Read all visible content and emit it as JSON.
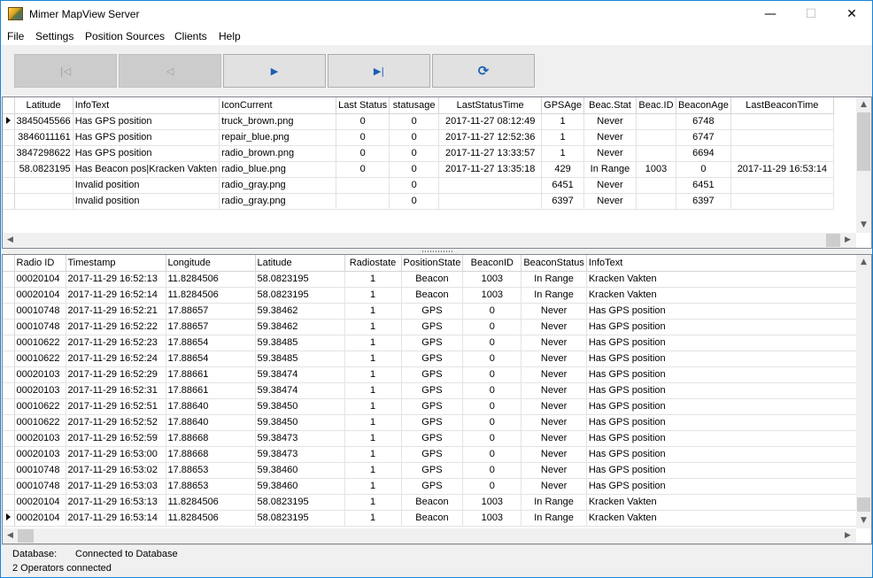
{
  "window": {
    "title": "Mimer MapView Server",
    "minimize_glyph": "—",
    "maximize_glyph": "☐",
    "close_glyph": "✕"
  },
  "menu": [
    "File",
    "Settings",
    "Position Sources",
    "Clients",
    "Help"
  ],
  "toolbar": {
    "first_glyph": "|◁",
    "prev_glyph": "◁",
    "play_glyph": "▶",
    "last_glyph": "▶|",
    "refresh_glyph": "⟳"
  },
  "top_grid": {
    "columns": [
      "Latitude",
      "InfoText",
      "IconCurrent",
      "Last Status",
      "statusage",
      "LastStatusTime",
      "GPSAge",
      "Beac.Stat",
      "Beac.ID",
      "BeaconAge",
      "LastBeaconTime"
    ],
    "rows": [
      [
        "3845045566",
        "Has GPS position",
        "truck_brown.png",
        "0",
        "0",
        "2017-11-27 08:12:49",
        "1",
        "Never",
        "",
        "6748",
        ""
      ],
      [
        "3846011161",
        "Has GPS position",
        "repair_blue.png",
        "0",
        "0",
        "2017-11-27 12:52:36",
        "1",
        "Never",
        "",
        "6747",
        ""
      ],
      [
        "3847298622",
        "Has GPS position",
        "radio_brown.png",
        "0",
        "0",
        "2017-11-27 13:33:57",
        "1",
        "Never",
        "",
        "6694",
        ""
      ],
      [
        "58.0823195",
        "Has Beacon pos|Kracken Vakten",
        "radio_blue.png",
        "0",
        "0",
        "2017-11-27 13:35:18",
        "429",
        "In Range",
        "1003",
        "0",
        "2017-11-29 16:53:14"
      ],
      [
        "",
        "Invalid position",
        "radio_gray.png",
        "",
        "0",
        "",
        "6451",
        "Never",
        "",
        "6451",
        ""
      ],
      [
        "",
        "Invalid position",
        "radio_gray.png",
        "",
        "0",
        "",
        "6397",
        "Never",
        "",
        "6397",
        ""
      ]
    ]
  },
  "bottom_grid": {
    "columns": [
      "Radio ID",
      "Timestamp",
      "Longitude",
      "Latitude",
      "Radiostate",
      "PositionState",
      "BeaconID",
      "BeaconStatus",
      "InfoText"
    ],
    "rows": [
      [
        "00020104",
        "2017-11-29 16:52:13",
        "11.8284506",
        "58.0823195",
        "1",
        "Beacon",
        "1003",
        "In Range",
        "Kracken Vakten"
      ],
      [
        "00020104",
        "2017-11-29 16:52:14",
        "11.8284506",
        "58.0823195",
        "1",
        "Beacon",
        "1003",
        "In Range",
        "Kracken Vakten"
      ],
      [
        "00010748",
        "2017-11-29 16:52:21",
        "17.88657",
        "59.38462",
        "1",
        "GPS",
        "0",
        "Never",
        "Has GPS position"
      ],
      [
        "00010748",
        "2017-11-29 16:52:22",
        "17.88657",
        "59.38462",
        "1",
        "GPS",
        "0",
        "Never",
        "Has GPS position"
      ],
      [
        "00010622",
        "2017-11-29 16:52:23",
        "17.88654",
        "59.38485",
        "1",
        "GPS",
        "0",
        "Never",
        "Has GPS position"
      ],
      [
        "00010622",
        "2017-11-29 16:52:24",
        "17.88654",
        "59.38485",
        "1",
        "GPS",
        "0",
        "Never",
        "Has GPS position"
      ],
      [
        "00020103",
        "2017-11-29 16:52:29",
        "17.88661",
        "59.38474",
        "1",
        "GPS",
        "0",
        "Never",
        "Has GPS position"
      ],
      [
        "00020103",
        "2017-11-29 16:52:31",
        "17.88661",
        "59.38474",
        "1",
        "GPS",
        "0",
        "Never",
        "Has GPS position"
      ],
      [
        "00010622",
        "2017-11-29 16:52:51",
        "17.88640",
        "59.38450",
        "1",
        "GPS",
        "0",
        "Never",
        "Has GPS position"
      ],
      [
        "00010622",
        "2017-11-29 16:52:52",
        "17.88640",
        "59.38450",
        "1",
        "GPS",
        "0",
        "Never",
        "Has GPS position"
      ],
      [
        "00020103",
        "2017-11-29 16:52:59",
        "17.88668",
        "59.38473",
        "1",
        "GPS",
        "0",
        "Never",
        "Has GPS position"
      ],
      [
        "00020103",
        "2017-11-29 16:53:00",
        "17.88668",
        "59.38473",
        "1",
        "GPS",
        "0",
        "Never",
        "Has GPS position"
      ],
      [
        "00010748",
        "2017-11-29 16:53:02",
        "17.88653",
        "59.38460",
        "1",
        "GPS",
        "0",
        "Never",
        "Has GPS position"
      ],
      [
        "00010748",
        "2017-11-29 16:53:03",
        "17.88653",
        "59.38460",
        "1",
        "GPS",
        "0",
        "Never",
        "Has GPS position"
      ],
      [
        "00020104",
        "2017-11-29 16:53:13",
        "11.8284506",
        "58.0823195",
        "1",
        "Beacon",
        "1003",
        "In Range",
        "Kracken Vakten"
      ],
      [
        "00020104",
        "2017-11-29 16:53:14",
        "11.8284506",
        "58.0823195",
        "1",
        "Beacon",
        "1003",
        "In Range",
        "Kracken Vakten"
      ]
    ]
  },
  "status": {
    "database_label": "Database:",
    "database_value": "Connected to Database",
    "operators": "2 Operators connected"
  }
}
